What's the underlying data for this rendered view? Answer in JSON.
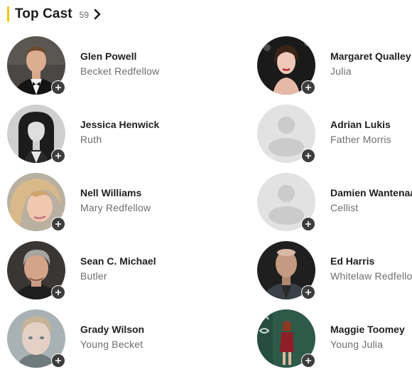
{
  "header": {
    "title": "Top Cast",
    "count": "59",
    "accent_color": "#f5c518"
  },
  "cast": [
    {
      "name": "Glen Powell",
      "character": "Becket Redfellow",
      "photo": "photo"
    },
    {
      "name": "Margaret Qualley",
      "character": "Julia",
      "photo": "photo"
    },
    {
      "name": "Jessica Henwick",
      "character": "Ruth",
      "photo": "photo"
    },
    {
      "name": "Adrian Lukis",
      "character": "Father Morris",
      "photo": "placeholder"
    },
    {
      "name": "Nell Williams",
      "character": "Mary Redfellow",
      "photo": "photo"
    },
    {
      "name": "Damien Wantenaar",
      "character": "Cellist",
      "photo": "placeholder"
    },
    {
      "name": "Sean C. Michael",
      "character": "Butler",
      "photo": "photo"
    },
    {
      "name": "Ed Harris",
      "character": "Whitelaw Redfellow",
      "photo": "photo"
    },
    {
      "name": "Grady Wilson",
      "character": "Young Becket",
      "photo": "photo"
    },
    {
      "name": "Maggie Toomey",
      "character": "Young Julia",
      "photo": "photo"
    }
  ],
  "icons": {
    "add": "plus-icon",
    "see_all": "chevron-right-icon",
    "placeholder": "person-silhouette-icon"
  }
}
